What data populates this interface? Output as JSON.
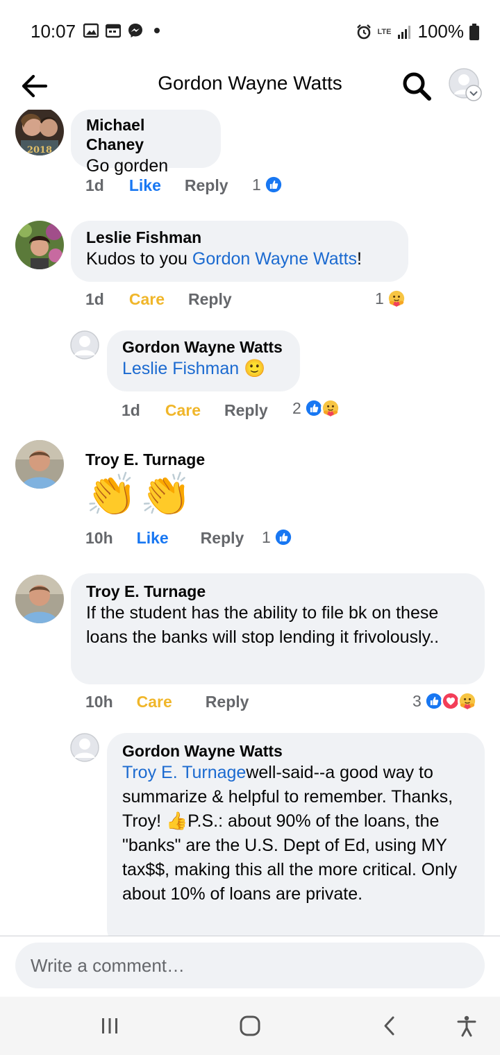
{
  "status_bar": {
    "time": "10:07",
    "network": "LTE",
    "battery": "100%"
  },
  "header": {
    "title": "Gordon Wayne Watts"
  },
  "comments": [
    {
      "author": "Michael Chaney",
      "text": "Go gorden",
      "time": "1d",
      "reaction_label": "Like",
      "reply_label": "Reply",
      "reaction_count": "1",
      "reaction_icons": [
        "like-reaction-icon"
      ]
    },
    {
      "author": "Leslie Fishman",
      "text_before": "Kudos to you ",
      "mention": "Gordon Wayne Watts",
      "text_after": "!",
      "time": "1d",
      "reaction_label": "Care",
      "reply_label": "Reply",
      "reaction_count": "1",
      "reaction_icons": [
        "care-reaction-icon"
      ]
    },
    {
      "author": "Gordon Wayne Watts",
      "mention": "Leslie Fishman",
      "emoji": "🙂",
      "time": "1d",
      "reaction_label": "Care",
      "reply_label": "Reply",
      "reaction_count": "2",
      "reaction_icons": [
        "like-reaction-icon",
        "care-reaction-icon"
      ]
    },
    {
      "author": "Troy E. Turnage",
      "emoji": "👏👏",
      "time": "10h",
      "reaction_label": "Like",
      "reply_label": "Reply",
      "reaction_count": "1",
      "reaction_icons": [
        "like-reaction-icon"
      ]
    },
    {
      "author": "Troy E. Turnage",
      "text": "If the student has the ability to file bk on these loans the banks will stop lending it frivolously..",
      "time": "10h",
      "reaction_label": "Care",
      "reply_label": "Reply",
      "reaction_count": "3",
      "reaction_icons": [
        "like-reaction-icon",
        "love-reaction-icon",
        "care-reaction-icon"
      ]
    },
    {
      "author": "Gordon Wayne Watts",
      "mention": "Troy E. Turnage",
      "text_before": "well-said--a good way to summarize & helpful to remember. Thanks, Troy! ",
      "thumb_emoji": "👍",
      "text_after": "P.S.: about 90% of the loans, the \"banks\" are the U.S. Dept of Ed, using MY tax$$, making this all the more critical. Only about 10% of loans are private."
    }
  ],
  "composer": {
    "placeholder": "Write a comment…"
  },
  "colors": {
    "link": "#1b6ad0",
    "like": "#1877f2",
    "care": "#f0b62a",
    "bubble": "#f0f2f5",
    "meta": "#65676b"
  }
}
